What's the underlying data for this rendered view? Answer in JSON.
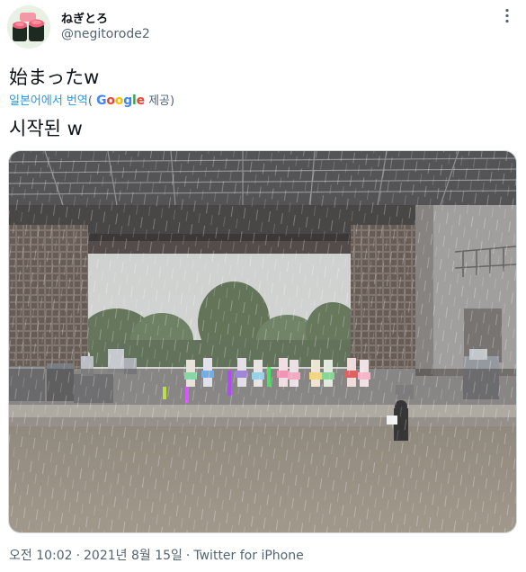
{
  "user": {
    "display_name": "ねぎとろ",
    "handle": "@negitorode2",
    "avatar_icon": "sushi-avatar-icon"
  },
  "tweet": {
    "text": "始まったw",
    "translate": {
      "label": "일본어에서 번역",
      "paren_open": "(",
      "provider": "Google",
      "provider_suffix": " 제공)"
    },
    "translated_text": "시작된 w",
    "media": {
      "alt_icon": "photo-icon"
    }
  },
  "meta": {
    "time": "오전 10:02",
    "separator": "·",
    "date": "2021년 8월 15일",
    "source": "Twitter for iPhone"
  },
  "colors": {
    "link": "#1d9bf0",
    "secondary": "#536471",
    "primary": "#0f1419",
    "google_blue": "#4285f4",
    "google_red": "#ea4335",
    "google_yellow": "#fbbc05",
    "google_green": "#34a853"
  }
}
